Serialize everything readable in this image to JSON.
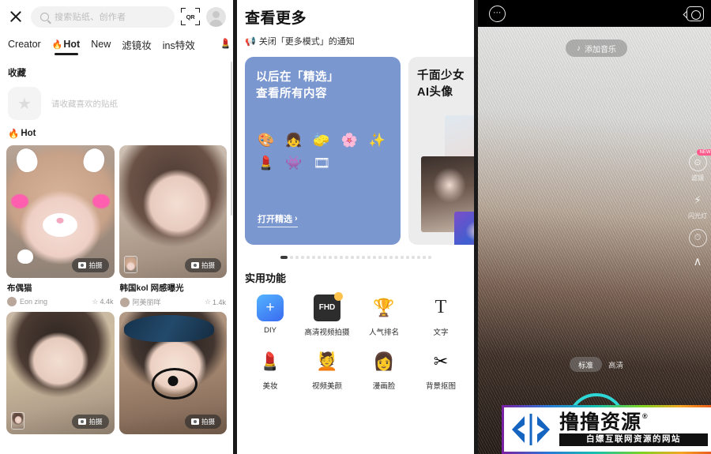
{
  "stickers_panel": {
    "topbar": {
      "close_label": "×",
      "search_placeholder": "搜索贴纸、创作者",
      "qr_label": "QR",
      "avatar_label": "用户头像"
    },
    "tabs": [
      {
        "label": "Creator",
        "icon": "",
        "active": false
      },
      {
        "label": "Hot",
        "icon": "🔥",
        "active": true
      },
      {
        "label": "New",
        "icon": "",
        "active": false
      },
      {
        "label": "滤镜妆",
        "icon": "",
        "active": false
      },
      {
        "label": "ins特效",
        "icon": "",
        "active": false
      }
    ],
    "tab_overflow_icon": "💄",
    "favorites": {
      "title": "收藏",
      "empty_hint": "请收藏喜欢的贴纸",
      "star_icon": "★"
    },
    "hot": {
      "title": "Hot",
      "icon": "🔥"
    },
    "shoot_label": "拍摄",
    "cards": [
      {
        "name": "布偶猫",
        "author": "Eon zing",
        "likes": "4.4k"
      },
      {
        "name": "韩国kol 网感曝光",
        "author": "阿美丽咩",
        "likes": "1.4k"
      }
    ]
  },
  "more_panel": {
    "title": "查看更多",
    "notice": "关闭「更多模式」的通知",
    "notice_icon": "📢",
    "banner_blue": {
      "line1": "以后在「精选」",
      "line2": "查看所有内容",
      "cta": "打开精选",
      "cta_arrow": "›",
      "bg_color": "#7b97cf",
      "emojis": [
        "🎨",
        "👧",
        "🧽",
        "🌸",
        "✨",
        "💄",
        "👾",
        "🎞"
      ]
    },
    "banner_grey": {
      "line1": "千面少女",
      "line2": "AI头像"
    },
    "carousel": {
      "total_dots": 27,
      "active_index": 0
    },
    "functions_title": "实用功能",
    "functions": [
      {
        "label": "DIY",
        "icon": "+",
        "kind": "diy"
      },
      {
        "label": "高清视频拍摄",
        "icon": "FHD",
        "kind": "fhd"
      },
      {
        "label": "人气排名",
        "icon": "🏆",
        "kind": "emoji"
      },
      {
        "label": "文字",
        "icon": "T",
        "kind": "txt"
      },
      {
        "label": "美妆",
        "icon": "💄",
        "kind": "emoji"
      },
      {
        "label": "视频美颜",
        "icon": "💆",
        "kind": "emoji"
      },
      {
        "label": "漫画脸",
        "icon": "👩",
        "kind": "emoji"
      },
      {
        "label": "背景抠图",
        "icon": "✂",
        "kind": "emoji"
      }
    ]
  },
  "camera_panel": {
    "topbar": {
      "menu_icon": "⋯",
      "flip_label": "翻转镜头"
    },
    "music_button": {
      "label": "添加音乐",
      "icon": "♪"
    },
    "side_tools": [
      {
        "label": "滤镜",
        "icon": "⊙",
        "badge": "NEW"
      },
      {
        "label": "闪光灯",
        "icon": "⚡",
        "badge": ""
      },
      {
        "label": "",
        "icon": "⏱",
        "badge": ""
      }
    ],
    "expand_icon": "∧",
    "quality": {
      "selected": "标准",
      "other": "高清"
    },
    "shutter_color": "#2fd6d6",
    "bottom_left_icon": "smiley-face",
    "bottom_right_icon": "filters"
  },
  "watermark": {
    "brand": "撸撸资源",
    "registered": "®",
    "tagline": "白嫖互联网资源的网站"
  }
}
